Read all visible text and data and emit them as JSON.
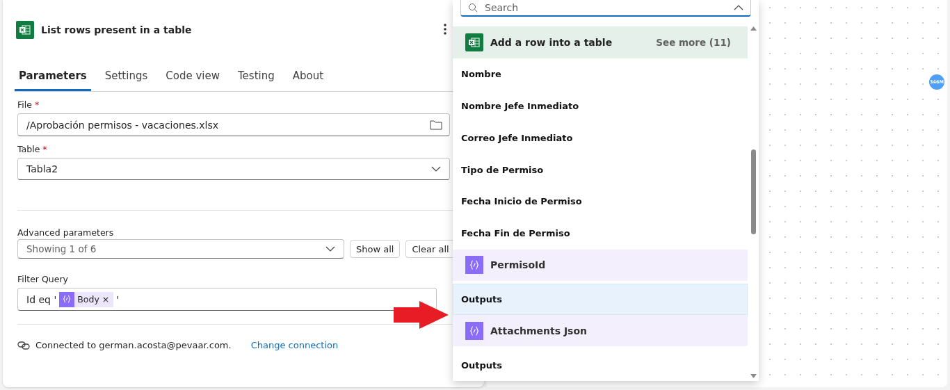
{
  "action": {
    "title": "List rows present in a table"
  },
  "tabs": [
    {
      "label": "Parameters",
      "selected": true
    },
    {
      "label": "Settings",
      "selected": false
    },
    {
      "label": "Code view",
      "selected": false
    },
    {
      "label": "Testing",
      "selected": false
    },
    {
      "label": "About",
      "selected": false
    }
  ],
  "file": {
    "label": "File",
    "required": true,
    "required_mark": "*",
    "value": "/Aprobación permisos - vacaciones.xlsx"
  },
  "table": {
    "label": "Table",
    "required": true,
    "required_mark": "*",
    "value": "Tabla2"
  },
  "advanced": {
    "label": "Advanced parameters",
    "value": "Showing 1 of 6",
    "buttons": [
      "Show all",
      "Clear all"
    ]
  },
  "filter_query": {
    "label": "Filter Query",
    "prefix": "Id eq '",
    "token": "Body",
    "token_remove": "×",
    "suffix": "'"
  },
  "connection": {
    "text": "Connected to german.acosta@pevaar.com.",
    "link": "Change connection"
  },
  "dropdown": {
    "search_placeholder": "Search",
    "group": {
      "title": "Add a row into a table",
      "see_more": "See more (11)"
    },
    "items": [
      {
        "kind": "field",
        "label": "Nombre",
        "highlighted": false
      },
      {
        "kind": "field",
        "label": "Nombre Jefe Inmediato",
        "highlighted": false
      },
      {
        "kind": "field",
        "label": "Correo Jefe Inmediato",
        "highlighted": false
      },
      {
        "kind": "field",
        "label": "Tipo de Permiso",
        "highlighted": false
      },
      {
        "kind": "field",
        "label": "Fecha Inicio de Permiso",
        "highlighted": false
      },
      {
        "kind": "field",
        "label": "Fecha Fin de Permiso",
        "highlighted": false
      },
      {
        "kind": "token",
        "label": "PermisoId",
        "highlighted": false
      },
      {
        "kind": "field",
        "label": "Outputs",
        "highlighted": true
      },
      {
        "kind": "token",
        "label": "Attachments Json",
        "highlighted": false
      },
      {
        "kind": "field",
        "label": "Outputs",
        "highlighted": false
      }
    ]
  },
  "canvas": {
    "badge": "346M"
  }
}
